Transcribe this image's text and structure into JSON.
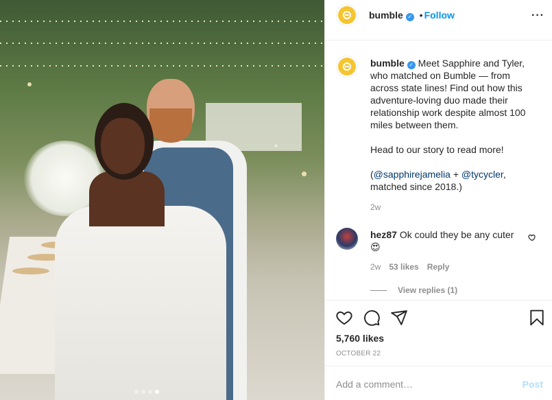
{
  "post": {
    "image_alt_dots": 4,
    "active_slide": 4
  },
  "header": {
    "username": "bumble",
    "separator": "•",
    "follow_label": "Follow",
    "more_label": "···"
  },
  "caption": {
    "username": "bumble",
    "lines_1": "Meet Sapphire and Tyler, who matched on Bumble — from across state lines! Find out how this adventure-loving duo made their relationship work despite almost 100 miles between them.",
    "lines_2": "Head to our story to read more!",
    "open_paren": "(",
    "mention_1": "@sapphirejamelia",
    "plus": " + ",
    "mention_2": "@tycycler",
    "lines_3_end": ", matched since 2018.)",
    "time": "2w"
  },
  "comment": {
    "username": "hez87",
    "text": "Ok could they be any cuter",
    "emoji": "😍",
    "time": "2w",
    "likes": "53 likes",
    "reply_label": "Reply",
    "view_replies": "View replies (1)"
  },
  "actions": {
    "likes": "5,760 likes",
    "date": "OCTOBER 22"
  },
  "add_comment": {
    "placeholder": "Add a comment…",
    "post_label": "Post"
  },
  "colors": {
    "link_blue": "#0095f6",
    "verified_blue": "#3897f0",
    "bumble_yellow": "#f5c531",
    "muted": "#8e8e8e"
  }
}
